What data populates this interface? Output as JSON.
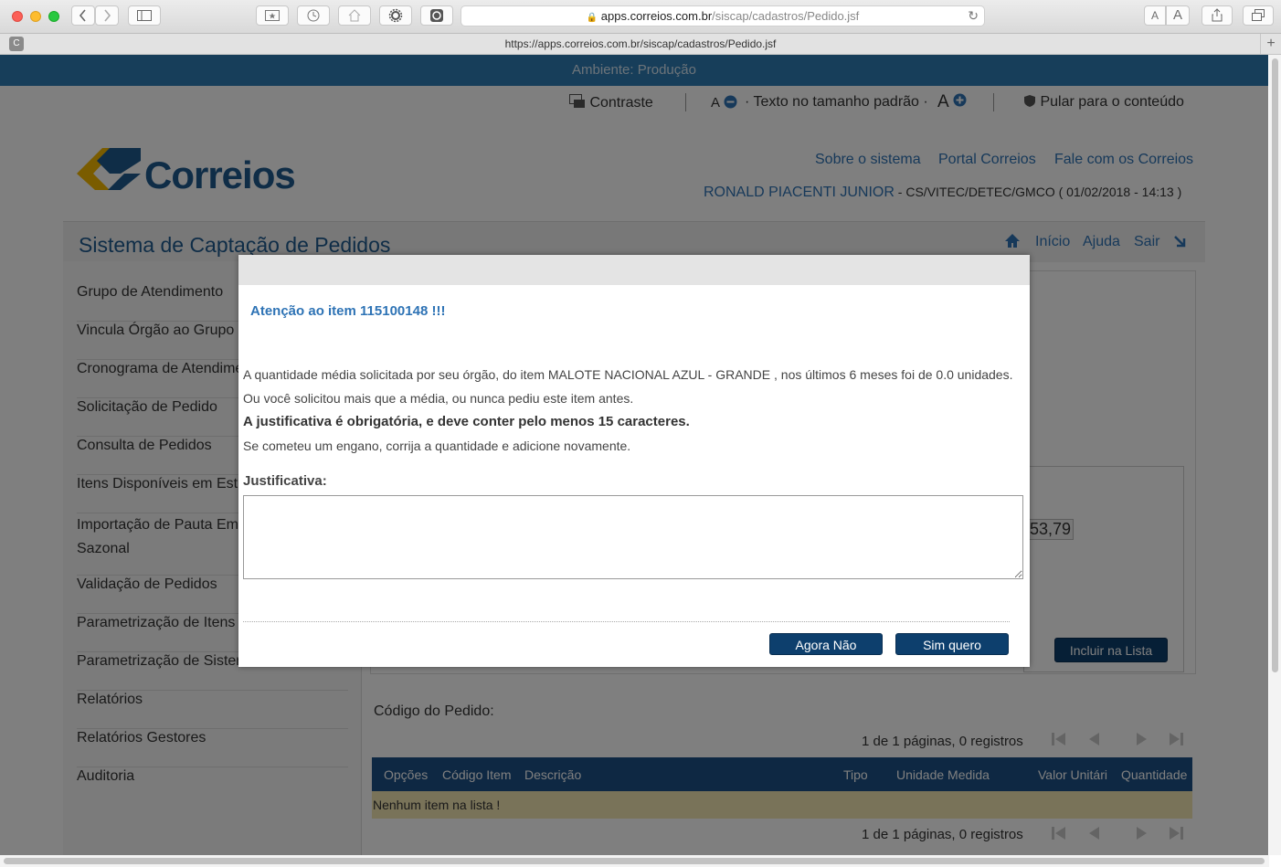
{
  "browser": {
    "url_host": "apps.correios.com.br",
    "url_path": "/siscap/cadastros/Pedido.jsf",
    "tab_title": "https://apps.correios.com.br/siscap/cadastros/Pedido.jsf",
    "tab_favicon_letter": "C",
    "font_small": "A",
    "font_large": "A"
  },
  "env_banner": "Ambiente: Produção",
  "accessibility": {
    "contrast": "Contraste",
    "font_minus": "A",
    "font_default": "· Texto no tamanho padrão ·",
    "font_plus": "A",
    "skip": "Pular para o conteúdo"
  },
  "header": {
    "logo_text": "Correios",
    "links": [
      "Sobre o sistema",
      "Portal Correios",
      "Fale com os Correios"
    ],
    "user_name": "RONALD PIACENTI JUNIOR",
    "user_info": " - CS/VITEC/DETEC/GMCO ( 01/02/2018 - 14:13 )"
  },
  "system": {
    "title": "Sistema de Captação de Pedidos",
    "nav": [
      "Início",
      "Ajuda",
      "Sair"
    ]
  },
  "menu": [
    "Grupo de Atendimento",
    "Vincula Órgão ao Grupo",
    "Cronograma de Atendime",
    "Solicitação de Pedido",
    "Consulta de Pedidos",
    "Itens Disponíveis em Est",
    "Importação de Pauta Em Sazonal",
    "Validação de Pedidos",
    "Parametrização de Itens",
    "Parametrização de Sister",
    "Relatórios",
    "Relatórios Gestores",
    "Auditoria"
  ],
  "main": {
    "value_fragment": "53,79",
    "include_button": "Incluir na Lista",
    "order_code_label": "Código do Pedido:",
    "pagination": "1 de 1 páginas, 0 registros",
    "table_headers": [
      "Opções",
      "Código Item",
      "Descrição",
      "Tipo",
      "Unidade Medida",
      "Valor Unitári",
      "Quantidade"
    ],
    "empty_row": "Nenhum item na lista !"
  },
  "dialog": {
    "title": "Atenção ao item 115100148 !!!",
    "line1": "A quantidade média solicitada por seu órgão, do item MALOTE NACIONAL AZUL - GRANDE , nos últimos 6 meses foi de 0.0 unidades.",
    "line2": "Ou você solicitou mais que a média, ou nunca pediu este item antes.",
    "line3": "A justificativa é obrigatória, e deve conter pelo menos 15 caracteres.",
    "line4": "Se cometeu um engano, corrija a quantidade e adicione novamente.",
    "justification_label": "Justificativa:",
    "justification_value": "",
    "button_no": "Agora Não",
    "button_yes": "Sim quero"
  },
  "colors": {
    "env_bar": "#2e7cb4",
    "link_blue": "#2e73b5",
    "button_navy": "#0d3f6d",
    "table_header": "#1d5186",
    "empty_row": "#f2e6b3"
  }
}
